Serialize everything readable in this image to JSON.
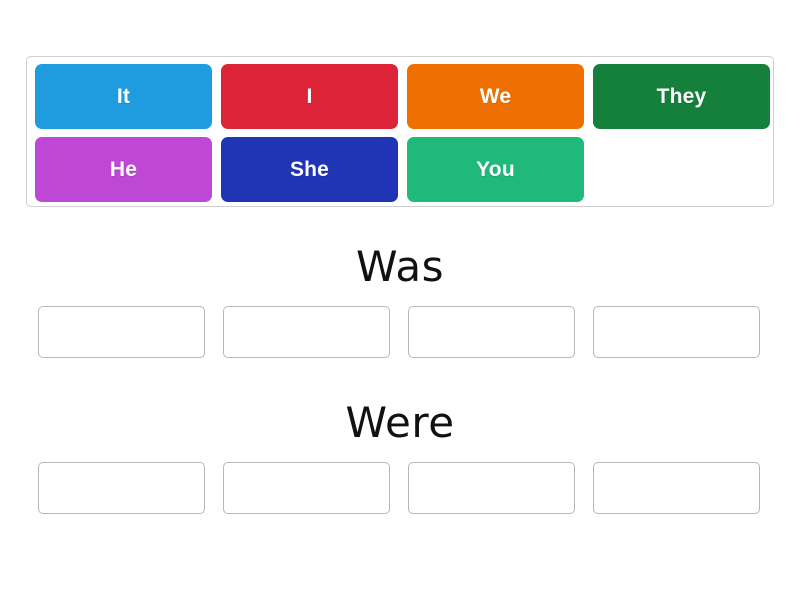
{
  "activity": {
    "type": "group-sort",
    "background_color": "#ffffff"
  },
  "tile_tray": {
    "border_color": "#cfcfcf",
    "rows": [
      [
        {
          "label": "It",
          "color": "#1f9ce0",
          "text_color": "#ffffff"
        },
        {
          "label": "I",
          "color": "#dd2337",
          "text_color": "#ffffff"
        },
        {
          "label": "We",
          "color": "#ef7000",
          "text_color": "#ffffff"
        },
        {
          "label": "They",
          "color": "#15803c",
          "text_color": "#ffffff"
        }
      ],
      [
        {
          "label": "He",
          "color": "#bf47d6",
          "text_color": "#ffffff"
        },
        {
          "label": "She",
          "color": "#1f35b5",
          "text_color": "#ffffff"
        },
        {
          "label": "You",
          "color": "#1fb97c",
          "text_color": "#ffffff"
        },
        {
          "label": "",
          "color": "",
          "text_color": ""
        }
      ]
    ]
  },
  "categories": [
    {
      "title": "Was",
      "dropzones": [
        {
          "value": ""
        },
        {
          "value": ""
        },
        {
          "value": ""
        },
        {
          "value": ""
        }
      ]
    },
    {
      "title": "Were",
      "dropzones": [
        {
          "value": ""
        },
        {
          "value": ""
        },
        {
          "value": ""
        },
        {
          "value": ""
        }
      ]
    }
  ]
}
